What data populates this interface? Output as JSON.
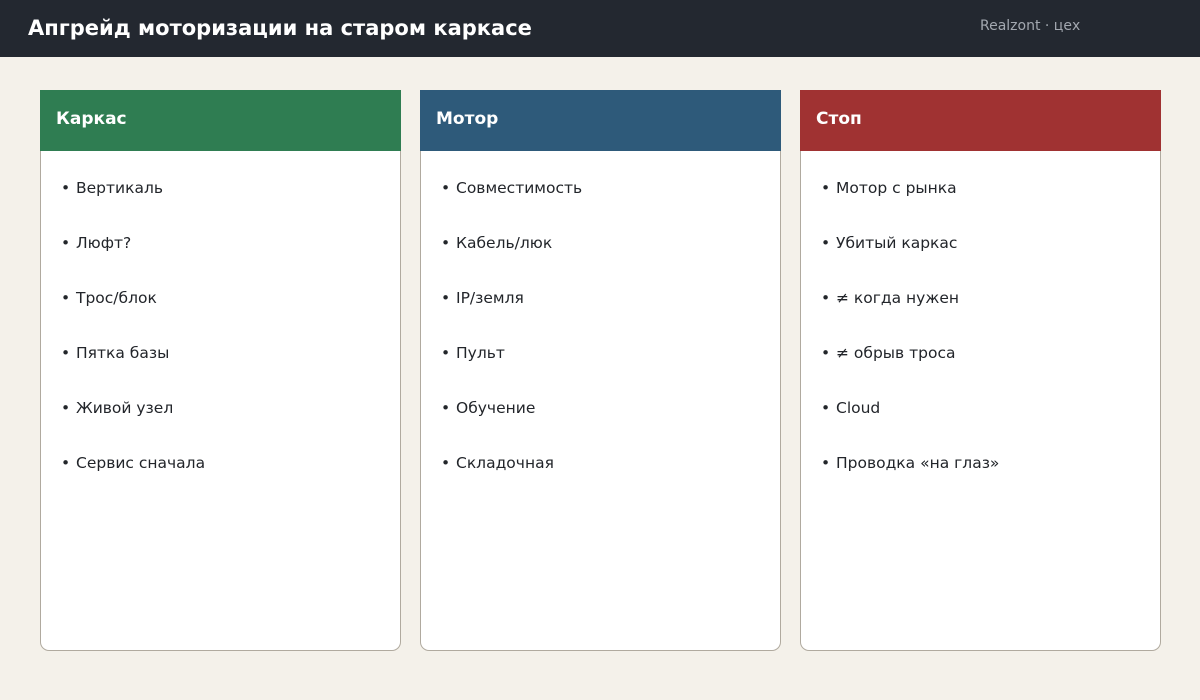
{
  "header": {
    "title": "Апгрейд моторизации на старом каркасе",
    "meta": "Realzont · цех"
  },
  "colors": {
    "topbar": "#232830",
    "page_background": "#f4f1ea",
    "frame_column": "#2f7d52",
    "motor_column": "#2e5a7a",
    "stop_column": "#a03232"
  },
  "bullet": "•",
  "columns": [
    {
      "title": "Каркас",
      "color": "#2f7d52",
      "items": [
        "Вертикаль",
        "Люфт?",
        "Трос/блок",
        "Пятка базы",
        "Живой узел",
        "Сервис сначала"
      ]
    },
    {
      "title": "Мотор",
      "color": "#2e5a7a",
      "items": [
        "Совместимость",
        "Кабель/люк",
        "IP/земля",
        "Пульт",
        "Обучение",
        "Складочная"
      ]
    },
    {
      "title": "Стоп",
      "color": "#a03232",
      "items": [
        "Мотор с рынка",
        "Убитый каркас",
        "≠ когда нужен",
        "≠ обрыв троса",
        "Cloud",
        "Проводка «на глаз»"
      ]
    }
  ]
}
